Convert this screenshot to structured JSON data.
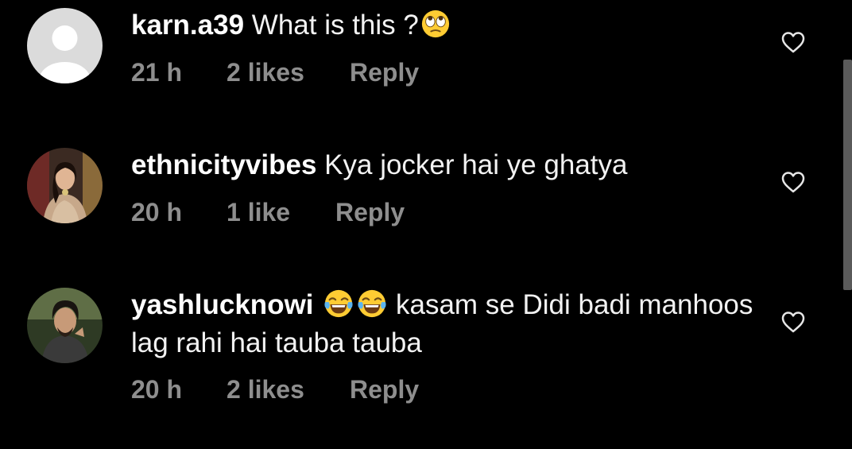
{
  "colors": {
    "background": "#000000",
    "text": "#ffffff",
    "meta_text": "#8e8e8e",
    "icon": "#e6e6e6"
  },
  "comments": [
    {
      "username": "karn.a39",
      "text": "What is this ?",
      "emoji": [
        "face-with-rolling-eyes"
      ],
      "time": "21 h",
      "likes": "2 likes",
      "reply_label": "Reply",
      "avatar": "default-avatar"
    },
    {
      "username": "ethnicityvibes",
      "text": "Kya jocker hai ye ghatya",
      "time": "20 h",
      "likes": "1 like",
      "reply_label": "Reply",
      "avatar": "user-photo"
    },
    {
      "username": "yashlucknowi",
      "emoji": [
        "face-with-tears-of-joy",
        "face-with-tears-of-joy"
      ],
      "text": "kasam se Didi badi manhoos lag rahi hai tauba tauba",
      "time": "20 h",
      "likes": "2 likes",
      "reply_label": "Reply",
      "avatar": "user-photo"
    }
  ],
  "icons": {
    "like": "heart-outline-icon"
  }
}
